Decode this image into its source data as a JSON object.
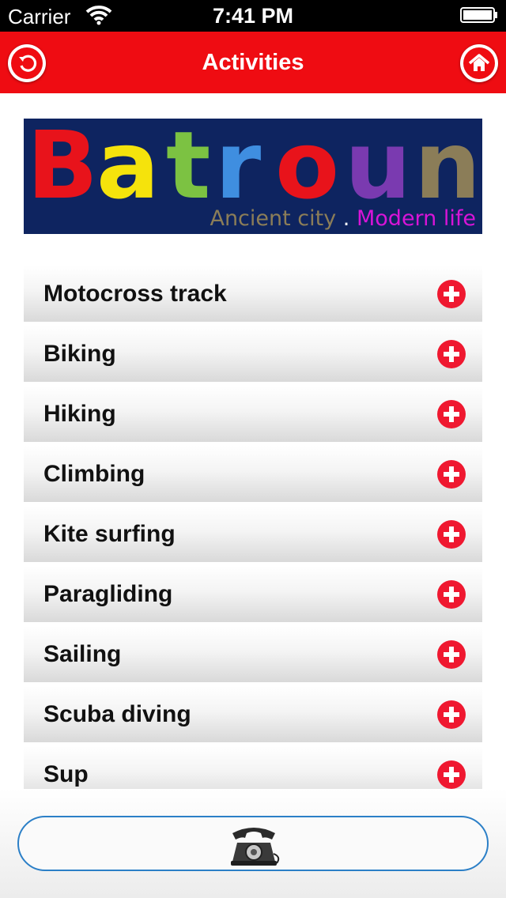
{
  "status": {
    "carrier": "Carrier",
    "time": "7:41 PM"
  },
  "nav": {
    "title": "Activities",
    "back_icon": "back-arrow-icon",
    "home_icon": "home-icon"
  },
  "banner": {
    "letters": [
      "B",
      "a",
      "t",
      "r",
      "o",
      "u",
      "n"
    ],
    "letter_colors": [
      "#e8131b",
      "#f5e30c",
      "#7cc242",
      "#3f8ee0",
      "#e8131b",
      "#7a3ab0",
      "#8b7d58"
    ],
    "tagline_part1": "Ancient city",
    "tagline_sep": ".",
    "tagline_part2": "Modern life"
  },
  "activities": [
    "Motocross track",
    "Biking",
    "Hiking",
    "Climbing",
    "Kite surfing",
    "Paragliding",
    "Sailing",
    "Scuba diving",
    "Sup"
  ],
  "footer": {
    "call_icon": "telephone-icon"
  },
  "colors": {
    "accent": "#ef0c12",
    "button_border": "#2b7fc7",
    "banner_bg": "#0e2460"
  }
}
